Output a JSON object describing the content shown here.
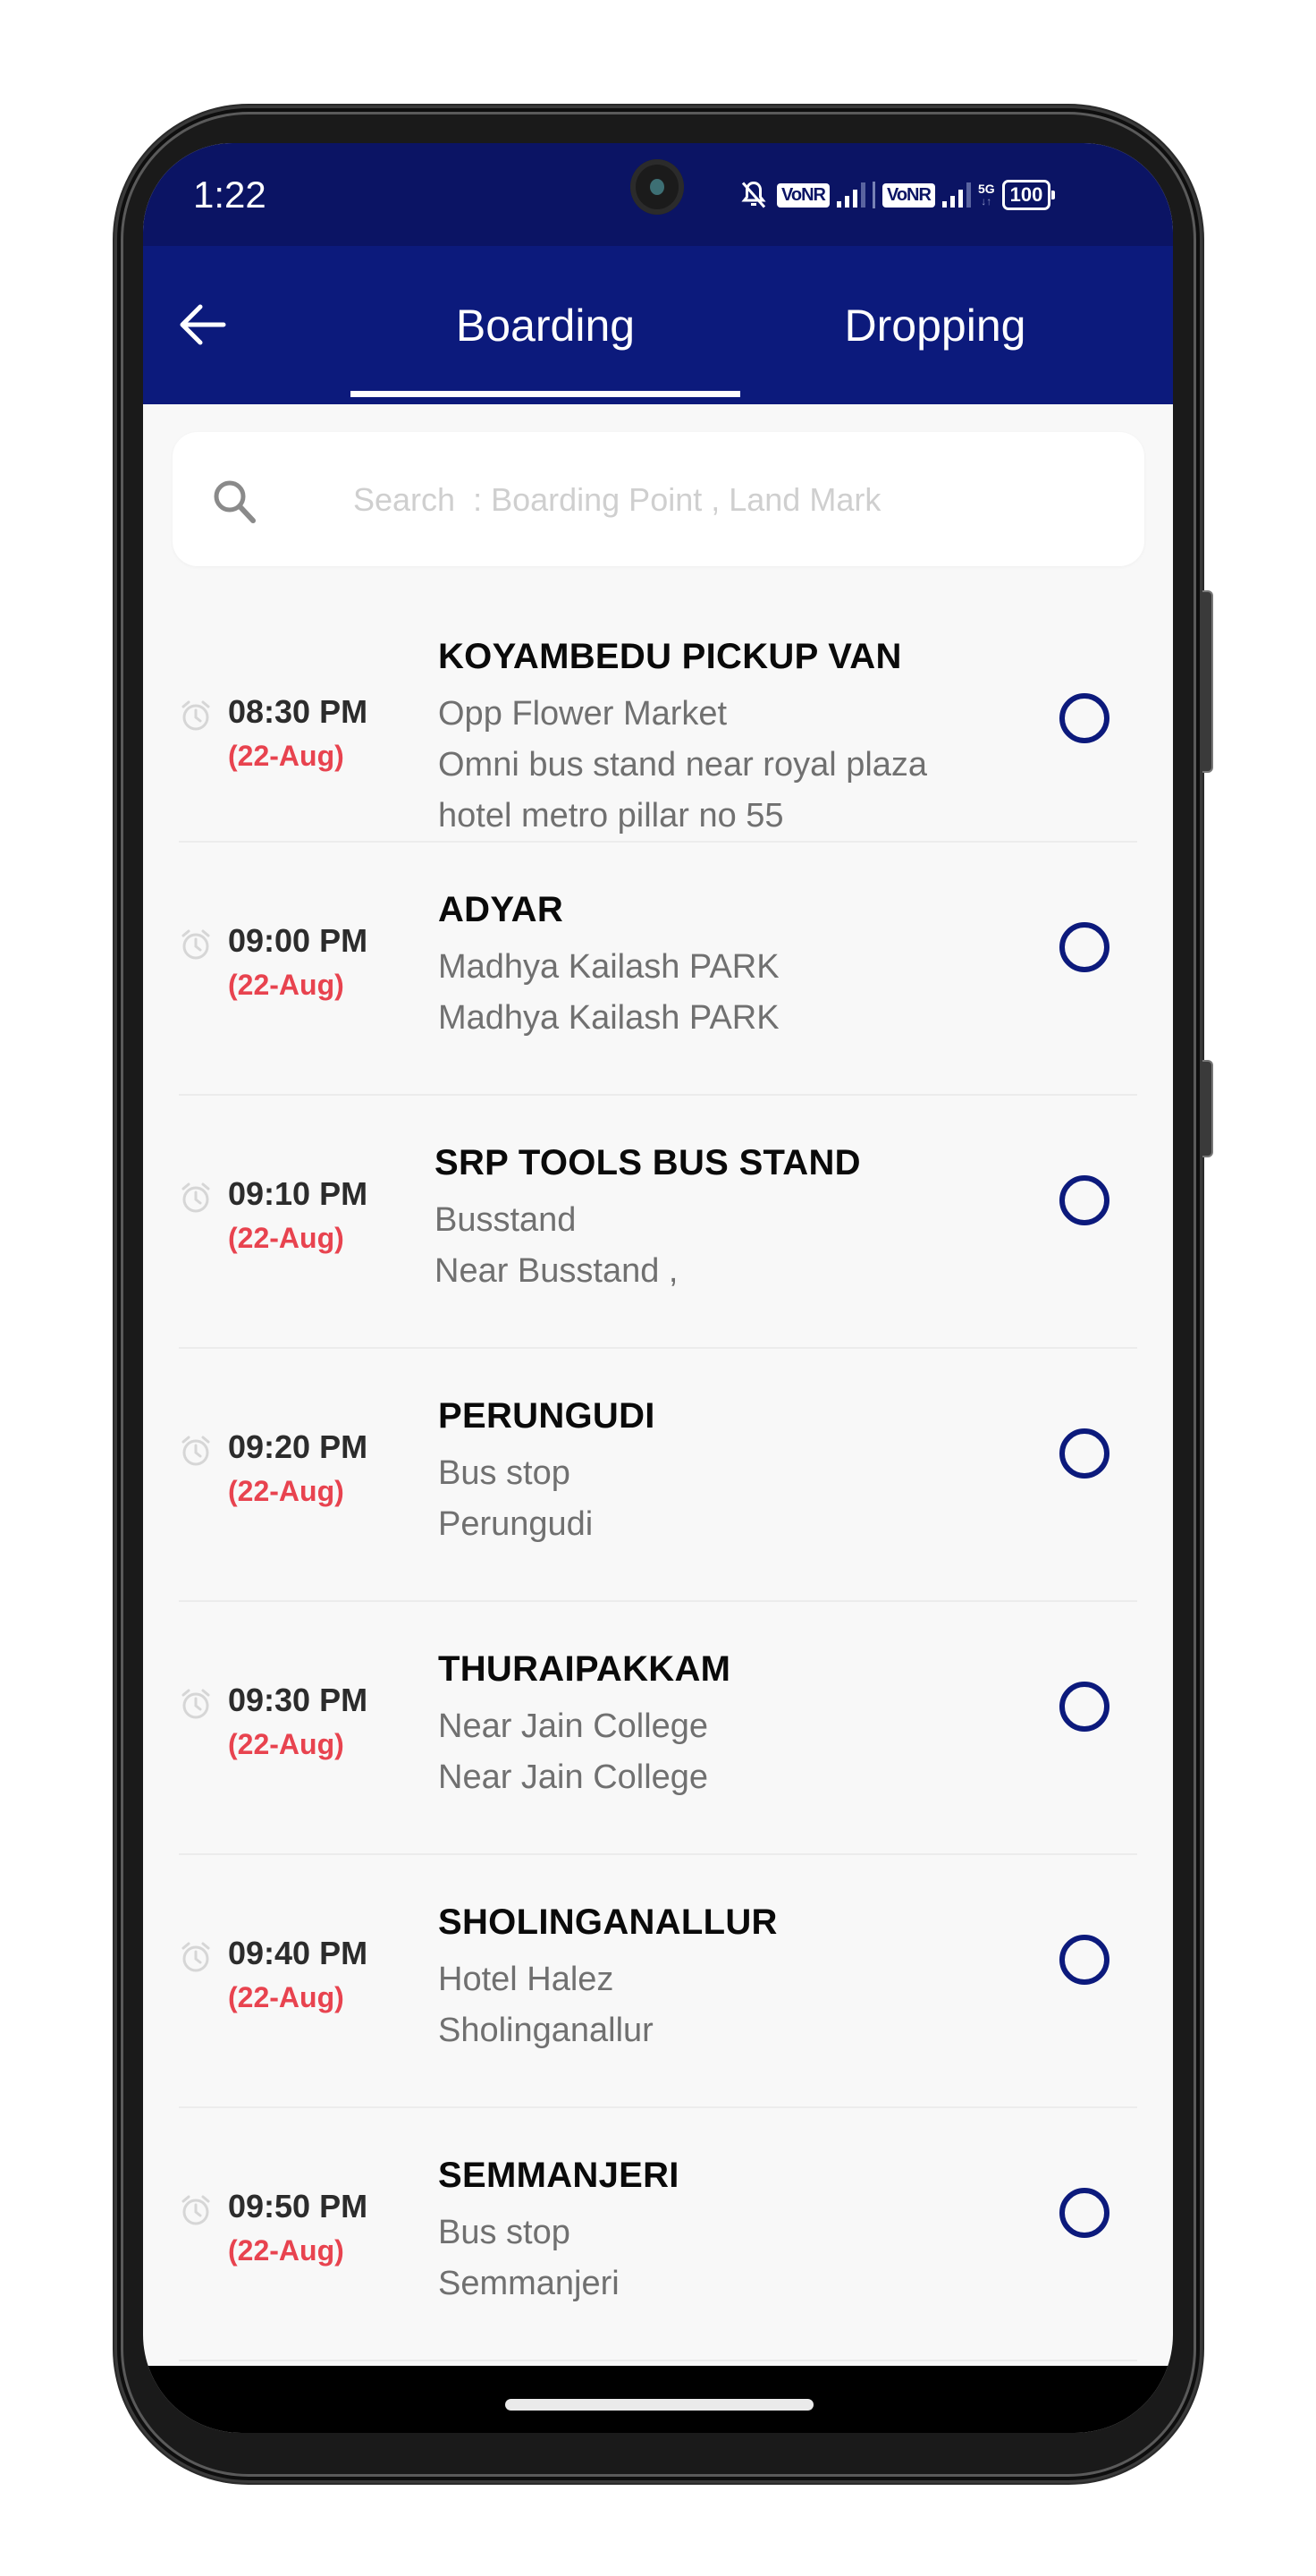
{
  "status_bar": {
    "time": "1:22",
    "icons": [
      "bell-muted-icon",
      "vonr-icon",
      "signal-icon",
      "vonr-icon",
      "signal-icon",
      "5g-icon",
      "battery-icon"
    ],
    "vonr_1": "VoNR",
    "vonr_2": "VoNR",
    "network": "5G",
    "battery": "100"
  },
  "app_bar": {
    "back_icon": "arrow-left-icon",
    "tabs": [
      {
        "label": "Boarding",
        "active": true
      },
      {
        "label": "Dropping",
        "active": false
      }
    ]
  },
  "search": {
    "icon": "search-icon",
    "value": "",
    "placeholder": "Search  : Boarding Point , Land Mark"
  },
  "colors": {
    "primary": "#0c1a7c",
    "status_bar": "#0b1464",
    "date_red": "#e8434f",
    "background": "#f8f8f8"
  },
  "boarding_points": [
    {
      "time": "08:30 PM",
      "date": "(22-Aug)",
      "name": "KOYAMBEDU PICKUP VAN",
      "address_lines": [
        "Opp Flower Market",
        "Omni bus stand near royal plaza",
        "hotel  metro pillar no 55"
      ],
      "selected": false
    },
    {
      "time": "09:00 PM",
      "date": "(22-Aug)",
      "name": "ADYAR",
      "address_lines": [
        "Madhya Kailash PARK",
        "Madhya Kailash PARK"
      ],
      "selected": false
    },
    {
      "time": "09:10 PM",
      "date": "(22-Aug)",
      "name": "SRP TOOLS BUS STAND",
      "address_lines": [
        "Busstand",
        "Near Busstand ,"
      ],
      "selected": false
    },
    {
      "time": "09:20 PM",
      "date": "(22-Aug)",
      "name": "PERUNGUDI",
      "address_lines": [
        "Bus stop",
        "Perungudi"
      ],
      "selected": false
    },
    {
      "time": "09:30 PM",
      "date": "(22-Aug)",
      "name": "THURAIPAKKAM",
      "address_lines": [
        "Near Jain College",
        "Near Jain College"
      ],
      "selected": false
    },
    {
      "time": "09:40 PM",
      "date": "(22-Aug)",
      "name": "SHOLINGANALLUR",
      "address_lines": [
        "Hotel Halez",
        "Sholinganallur"
      ],
      "selected": false
    },
    {
      "time": "09:50 PM",
      "date": "(22-Aug)",
      "name": "SEMMANJERI",
      "address_lines": [
        "Bus stop",
        "Semmanjeri"
      ],
      "selected": false
    }
  ]
}
